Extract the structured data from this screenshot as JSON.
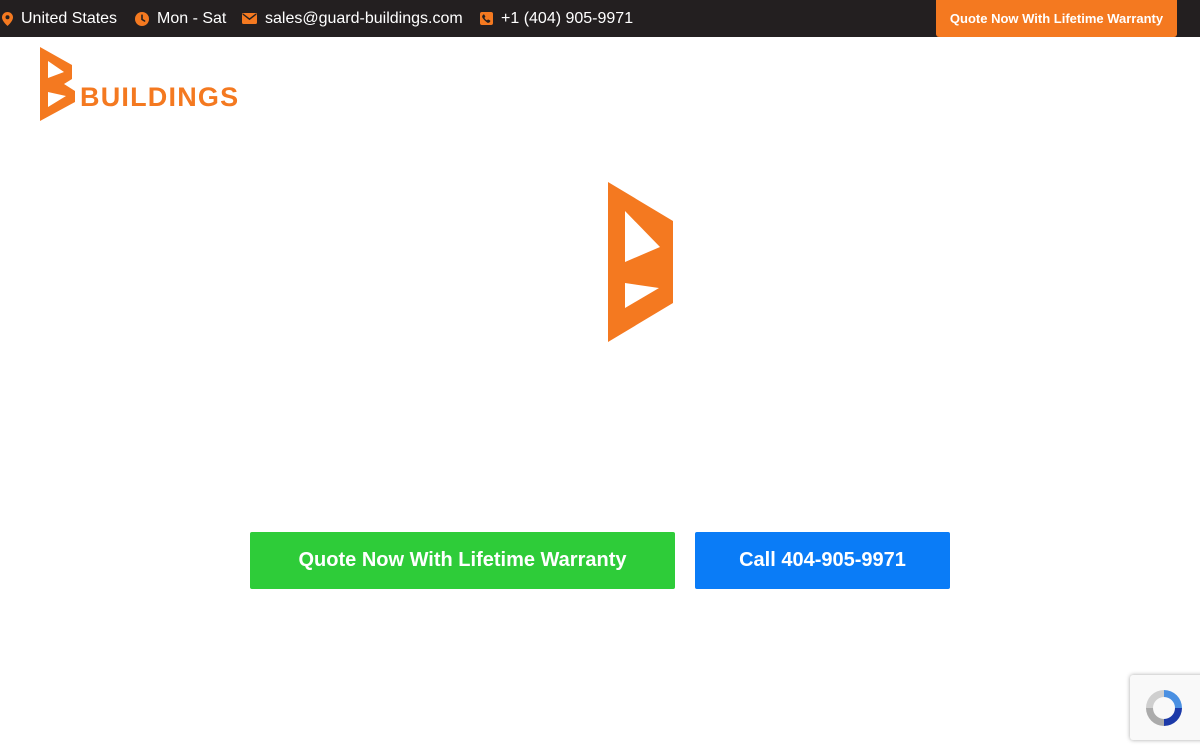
{
  "topbar": {
    "location": "United States",
    "hours": "Mon - Sat",
    "email": "sales@guard-buildings.com",
    "phone": "+1 (404) 905-9971",
    "quote_label": "Quote Now With Lifetime Warranty"
  },
  "logo": {
    "text": "BUILDINGS"
  },
  "cta": {
    "quote_label": "Quote Now With Lifetime Warranty",
    "call_label": "Call 404-905-9971"
  },
  "colors": {
    "topbar_bg": "#231f20",
    "brand_orange": "#f47920",
    "green": "#2ecc39",
    "blue": "#0a7cf7"
  },
  "icons": [
    "map-pin-icon",
    "clock-icon",
    "envelope-icon",
    "phone-icon",
    "recaptcha-icon"
  ]
}
